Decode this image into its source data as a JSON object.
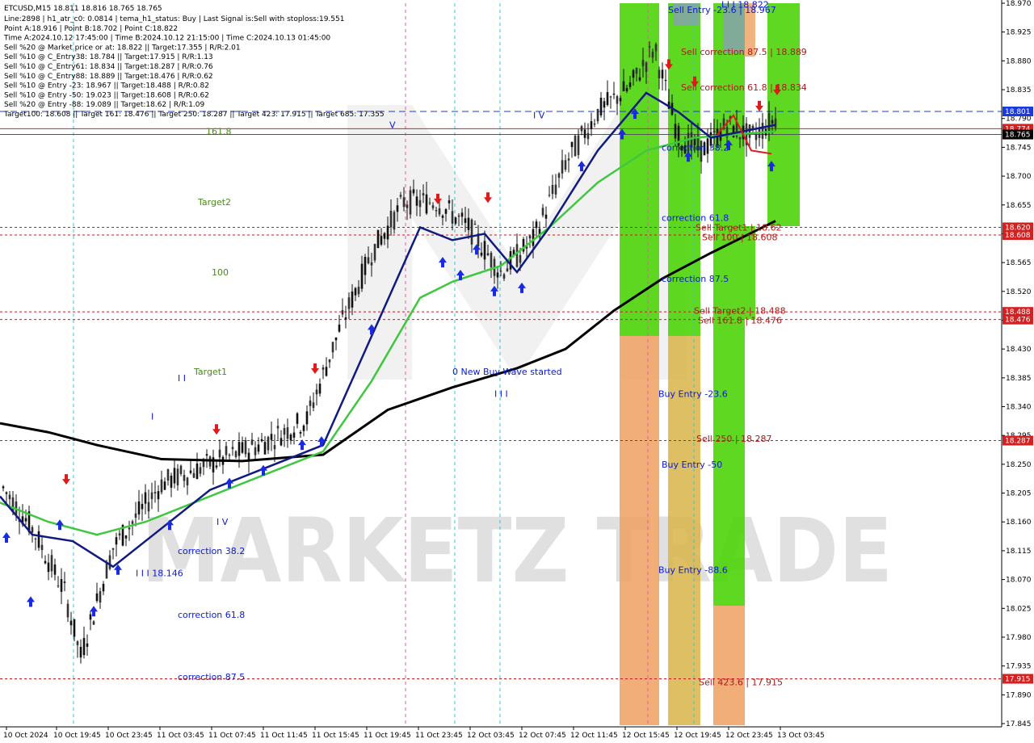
{
  "chart_data": {
    "type": "line",
    "symbol_line": "ETCUSD,M15  18.811 18.816 18.765 18.765",
    "info_lines": [
      "Line:2898  |  h1_atr_c0: 0.0814  |  tema_h1_status: Buy  |  Last Signal is:Sell with stoploss:19.551",
      "Point A:18.916  |  Point B:18.702  |  Point C:18.822",
      "Time A:2024.10.12 17:45:00  |  Time B:2024.10.12 21:15:00  |  Time C:2024.10.13 01:45:00",
      "Sell %20 @ Market price or at: 18.822  ||  Target:17.355  |  R/R:2.01",
      "Sell %10 @ C_Entry38: 18.784  ||  Target:17.915  |  R/R:1.13",
      "Sell %10 @ C_Entry61: 18.834  ||  Target:18.287  |  R/R:0.76",
      "Sell %10 @ C_Entry88: 18.889  ||  Target:18.476  |  R/R:0.62",
      "Sell %10 @ Entry -23: 18.967  ||  Target:18.488  |  R/R:0.82",
      "Sell %10 @ Entry -50: 19.023  ||  Target:18.608  |  R/R:0.62",
      "Sell %20 @ Entry -88: 19.089  ||  Target:18.62  |  R/R:1.09",
      "Target100: 18.608  ||  Target 161: 18.476  ||  Target 250: 18.287  ||  Target 423: 17.915  ||  Target 685: 17.355"
    ],
    "y_ticks": [
      "18.970",
      "18.925",
      "18.880",
      "18.835",
      "18.790",
      "18.745",
      "18.700",
      "18.655",
      "18.610",
      "18.565",
      "18.520",
      "18.475",
      "18.430",
      "18.385",
      "18.340",
      "18.295",
      "18.250",
      "18.205",
      "18.160",
      "18.115",
      "18.070",
      "18.025",
      "17.980",
      "17.935",
      "17.890",
      "17.845"
    ],
    "ylim": [
      17.845,
      18.97
    ],
    "x_ticks": [
      "10 Oct 2024",
      "10 Oct 19:45",
      "10 Oct 23:45",
      "11 Oct 03:45",
      "11 Oct 07:45",
      "11 Oct 11:45",
      "11 Oct 15:45",
      "11 Oct 19:45",
      "11 Oct 23:45",
      "12 Oct 03:45",
      "12 Oct 07:45",
      "12 Oct 11:45",
      "12 Oct 15:45",
      "12 Oct 19:45",
      "12 Oct 23:45",
      "13 Oct 03:45"
    ],
    "price_boxes": [
      {
        "label": "18.801",
        "value": 18.801,
        "color": "#1a3adf"
      },
      {
        "label": "18.774",
        "value": 18.774,
        "color": "#d42020"
      },
      {
        "label": "18.765",
        "value": 18.765,
        "color": "#000000"
      },
      {
        "label": "18.620",
        "value": 18.62,
        "color": "#d42020"
      },
      {
        "label": "18.608",
        "value": 18.608,
        "color": "#d42020"
      },
      {
        "label": "18.488",
        "value": 18.488,
        "color": "#d42020"
      },
      {
        "label": "18.476",
        "value": 18.476,
        "color": "#d42020"
      },
      {
        "label": "18.287",
        "value": 18.287,
        "color": "#d42020"
      },
      {
        "label": "17.915",
        "value": 17.915,
        "color": "#d42020"
      }
    ],
    "hlines": [
      {
        "value": 18.801,
        "color": "#1a3adf",
        "dash": "8,5"
      },
      {
        "value": 18.774,
        "color": "#d42020",
        "dash": ""
      },
      {
        "value": 18.765,
        "color": "#555555",
        "dash": ""
      },
      {
        "value": 18.62,
        "color": "#c02020",
        "dash": "3,3"
      },
      {
        "value": 18.608,
        "color": "#c02020",
        "dash": "3,3"
      },
      {
        "value": 18.488,
        "color": "#c02020",
        "dash": "3,3"
      },
      {
        "value": 18.476,
        "color": "#c02020",
        "dash": "3,3"
      },
      {
        "value": 18.287,
        "color": "#c02020",
        "dash": "3,3"
      },
      {
        "value": 17.915,
        "color": "#c02020",
        "dash": "3,3"
      }
    ],
    "annotations": [
      {
        "text": "Sell Entry -23.6 | 18.967",
        "value": 18.955,
        "class": "ann-blue"
      },
      {
        "text": "I I I  18.822",
        "value": 18.963,
        "class": "ann-blue"
      },
      {
        "text": "Sell correction 87.5 | 18.889",
        "value": 18.889,
        "class": "ann-red"
      },
      {
        "text": "Sell correction 61.8 | 18.834",
        "value": 18.834,
        "class": "ann-red"
      },
      {
        "text": "correction 38.2",
        "value": 18.74,
        "class": "ann-blue"
      },
      {
        "text": "correction 61.8",
        "value": 18.63,
        "class": "ann-blue"
      },
      {
        "text": "Sell Target1 | 18.62",
        "value": 18.615,
        "class": "ann-red"
      },
      {
        "text": "Sell 100 | 18.608",
        "value": 18.6,
        "class": "ann-red"
      },
      {
        "text": "correction 87.5",
        "value": 18.535,
        "class": "ann-blue"
      },
      {
        "text": "Sell Target2 | 18.488",
        "value": 18.485,
        "class": "ann-red"
      },
      {
        "text": "Sell 161.8 | 18.476",
        "value": 18.47,
        "class": "ann-red"
      },
      {
        "text": "Buy Entry -23.6",
        "value": 18.355,
        "class": "ann-blue"
      },
      {
        "text": "Sell  250 | 18.287",
        "value": 18.285,
        "class": "ann-red"
      },
      {
        "text": "Buy Entry -50",
        "value": 18.245,
        "class": "ann-blue"
      },
      {
        "text": "Buy Entry -88.6",
        "value": 18.08,
        "class": "ann-blue"
      },
      {
        "text": "Sell  423.6 | 17.915",
        "value": 17.905,
        "class": "ann-red"
      },
      {
        "text": "I V",
        "value": 18.79,
        "class": "ann-blue"
      },
      {
        "text": "V",
        "value": 18.775,
        "class": "ann-blue"
      },
      {
        "text": "0 New Buy Wave started",
        "value": 18.39,
        "class": "ann-blue"
      },
      {
        "text": "I I I",
        "value": 18.355,
        "class": "ann-blue"
      },
      {
        "text": "161.8",
        "value": 18.765,
        "class": "ann-green"
      },
      {
        "text": "Target2",
        "value": 18.655,
        "class": "ann-green"
      },
      {
        "text": "100",
        "value": 18.545,
        "class": "ann-green"
      },
      {
        "text": "Target1",
        "value": 18.39,
        "class": "ann-green"
      },
      {
        "text": "I I",
        "value": 18.38,
        "class": "ann-blue"
      },
      {
        "text": "I",
        "value": 18.32,
        "class": "ann-blue"
      },
      {
        "text": "I V",
        "value": 18.155,
        "class": "ann-blue"
      },
      {
        "text": "correction 38.2",
        "value": 18.11,
        "class": "ann-blue"
      },
      {
        "text": "I I I  18.146",
        "value": 18.075,
        "class": "ann-blue"
      },
      {
        "text": "correction 61.8",
        "value": 18.01,
        "class": "ann-blue"
      },
      {
        "text": "correction 87.5",
        "value": 17.913,
        "class": "ann-blue"
      }
    ],
    "watermark": "MARKETZ TRADE"
  }
}
